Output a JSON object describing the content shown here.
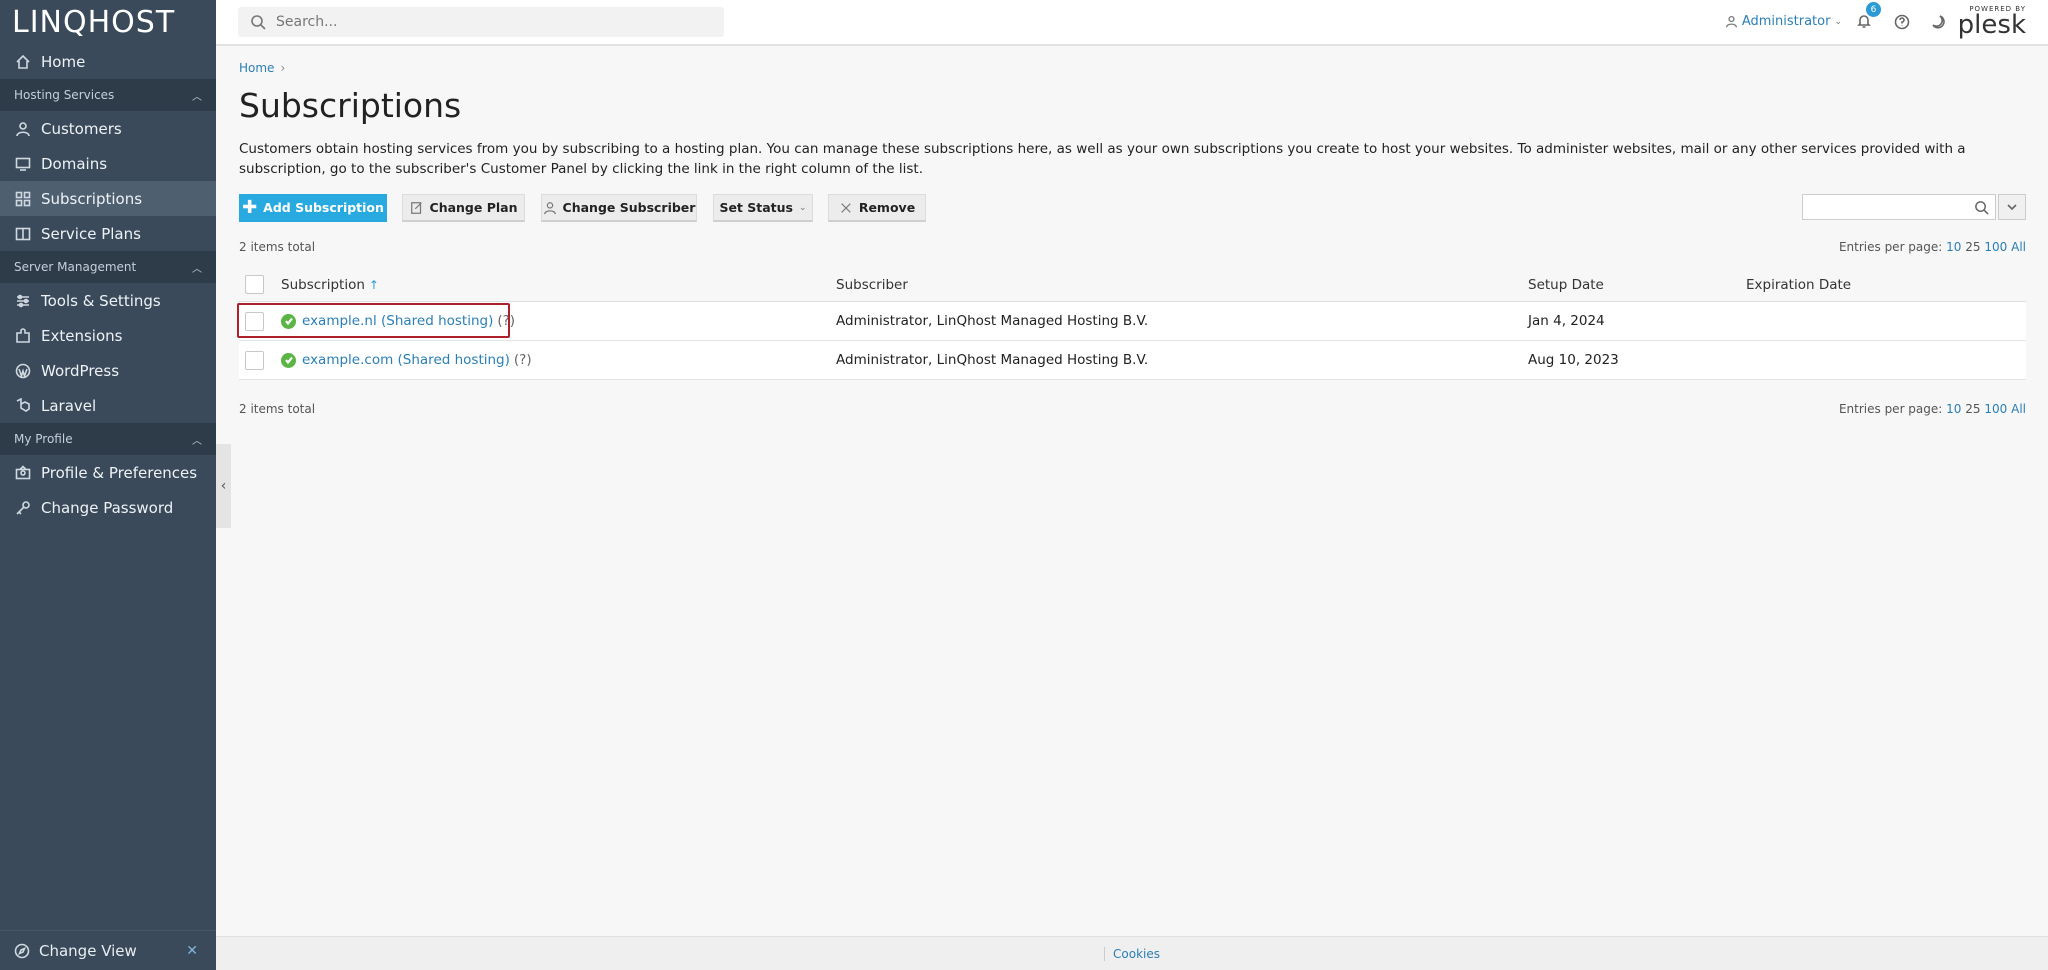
{
  "brand": {
    "logo": "LINQHOST",
    "powered_by": "POWERED BY",
    "product": "plesk"
  },
  "sidebar": {
    "home": "Home",
    "sections": [
      {
        "title": "Hosting Services",
        "items": [
          "Customers",
          "Domains",
          "Subscriptions",
          "Service Plans"
        ]
      },
      {
        "title": "Server Management",
        "items": [
          "Tools & Settings",
          "Extensions",
          "WordPress",
          "Laravel"
        ]
      },
      {
        "title": "My Profile",
        "items": [
          "Profile & Preferences",
          "Change Password"
        ]
      }
    ],
    "active": "Subscriptions",
    "change_view": "Change View"
  },
  "topbar": {
    "search_placeholder": "Search...",
    "user": "Administrator",
    "notifications_count": "6"
  },
  "breadcrumb": {
    "home": "Home"
  },
  "page": {
    "title": "Subscriptions",
    "description": "Customers obtain hosting services from you by subscribing to a hosting plan. You can manage these subscriptions here, as well as your own subscriptions you create to host your websites. To administer websites, mail or any other services provided with a subscription, go to the subscriber's Customer Panel by clicking the link in the right column of the list."
  },
  "toolbar": {
    "add": "Add Subscription",
    "change_plan": "Change Plan",
    "change_subscriber": "Change Subscriber",
    "set_status": "Set Status",
    "remove": "Remove"
  },
  "list": {
    "total_label": "2 items total",
    "entries_label": "Entries per page:",
    "page_sizes": [
      "10",
      "25",
      "100",
      "All"
    ],
    "columns": {
      "subscription": "Subscription",
      "subscriber": "Subscriber",
      "setup_date": "Setup Date",
      "expiration_date": "Expiration Date"
    },
    "rows": [
      {
        "subscription": "example.nl (Shared hosting)",
        "help": "(?)",
        "subscriber": "Administrator, LinQhost Managed Hosting B.V.",
        "setup_date": "Jan 4, 2024",
        "expiration_date": ""
      },
      {
        "subscription": "example.com (Shared hosting)",
        "help": "(?)",
        "subscriber": "Administrator, LinQhost Managed Hosting B.V.",
        "setup_date": "Aug 10, 2023",
        "expiration_date": ""
      }
    ]
  },
  "footer": {
    "cookies": "Cookies"
  },
  "colors": {
    "sidebar": "#3a4a5a",
    "accent": "#28aae1",
    "link": "#2a7fb8",
    "highlight": "#b0202a"
  }
}
